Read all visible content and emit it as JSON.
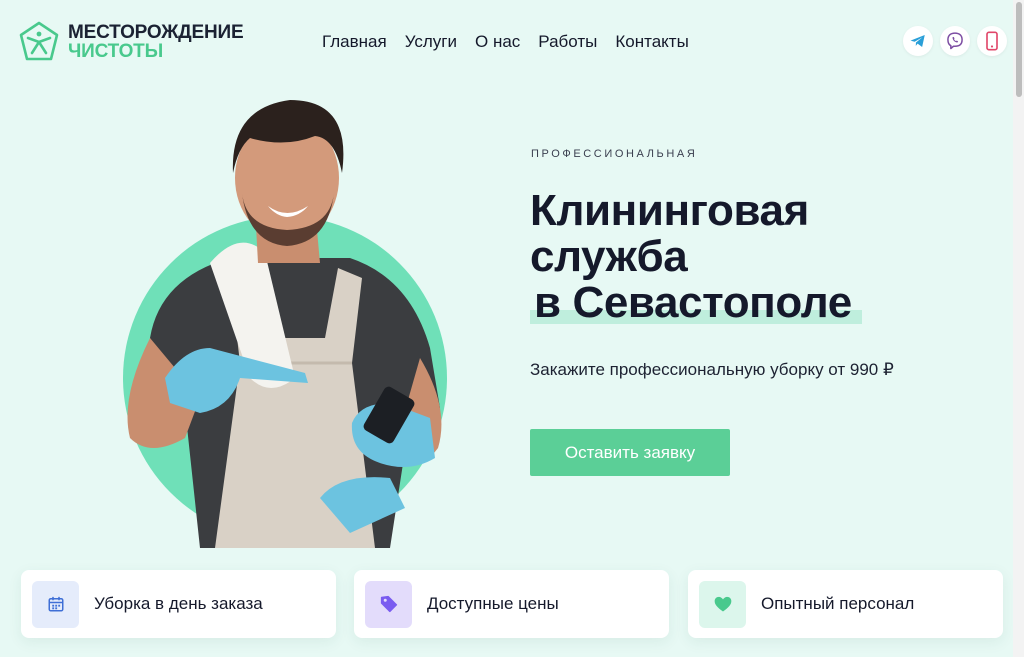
{
  "header": {
    "logo": {
      "line1": "МЕСТОРОЖДЕНИЕ",
      "line2": "ЧИСТОТЫ"
    },
    "nav": [
      {
        "label": "Главная"
      },
      {
        "label": "Услуги"
      },
      {
        "label": "О нас"
      },
      {
        "label": "Работы"
      },
      {
        "label": "Контакты"
      }
    ],
    "social": [
      {
        "icon": "telegram-icon",
        "color": "#2a9fd8"
      },
      {
        "icon": "viber-icon",
        "color": "#7d4ea3"
      },
      {
        "icon": "phone-icon",
        "color": "#e0476a"
      }
    ]
  },
  "hero": {
    "eyebrow": "ПРОФЕССИОНАЛЬНАЯ",
    "title_line1": "Клининговая",
    "title_line2": "служба",
    "title_line3": "в Севастополе",
    "subtitle": "Закажите профессиональную уборку от 990 ₽",
    "cta_label": "Оставить заявку"
  },
  "features": [
    {
      "label": "Уборка в день заказа",
      "icon": "calendar-icon",
      "color": "#3f6fd6"
    },
    {
      "label": "Доступные цены",
      "icon": "price-tag-icon",
      "color": "#7a5cf0"
    },
    {
      "label": "Опытный персонал",
      "icon": "heart-icon",
      "color": "#49c98d"
    }
  ],
  "colors": {
    "background": "#e7f9f4",
    "accent": "#5bcf97",
    "brand_green": "#49c98d",
    "text": "#15192b"
  }
}
